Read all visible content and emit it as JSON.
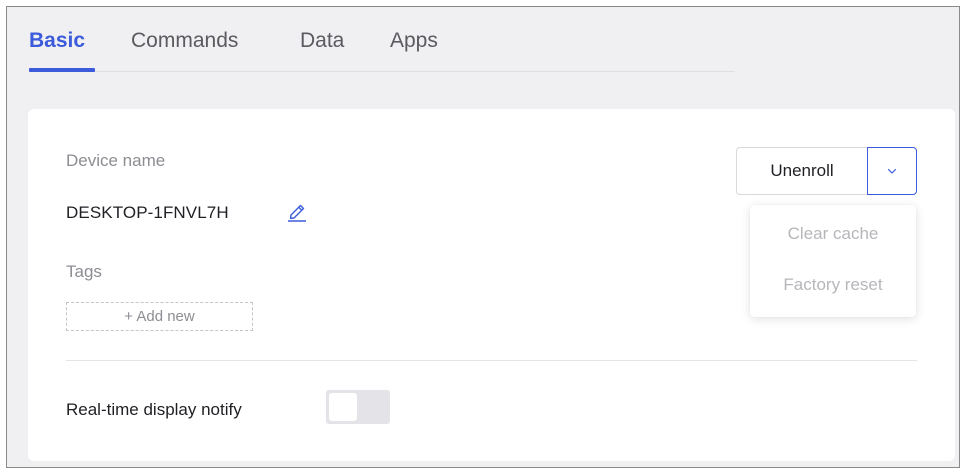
{
  "tabs": [
    {
      "label": "Basic",
      "active": true
    },
    {
      "label": "Commands",
      "active": false
    },
    {
      "label": "Data",
      "active": false
    },
    {
      "label": "Apps",
      "active": false
    }
  ],
  "device": {
    "name_label": "Device name",
    "name_value": "DESKTOP-1FNVL7H",
    "tags_label": "Tags",
    "add_new_label": "+ Add new"
  },
  "actions": {
    "unenroll_label": "Unenroll",
    "menu_items": [
      {
        "label": "Clear cache",
        "disabled": true
      },
      {
        "label": "Factory reset",
        "disabled": true
      }
    ]
  },
  "settings": {
    "realtime_notify_label": "Real-time display notify",
    "realtime_notify_enabled": false
  },
  "colors": {
    "accent": "#3b5bdb",
    "background": "#f0f0f3",
    "card": "#ffffff",
    "muted_text": "#8d8d93",
    "disabled_text": "#b6b6bb"
  },
  "icons": {
    "edit": "pencil-icon",
    "dropdown": "chevron-down-icon"
  }
}
